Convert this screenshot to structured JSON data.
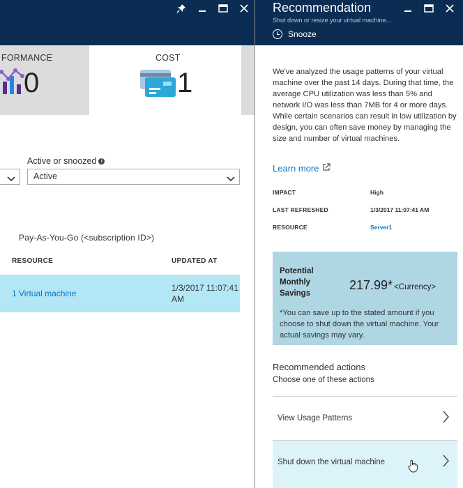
{
  "left_blade": {
    "tiles": {
      "performance": {
        "title": "FORMANCE",
        "count": "0",
        "icon": "performance-chart-icon"
      },
      "cost": {
        "title": "COST",
        "count": "1",
        "icon": "credit-card-icon"
      }
    },
    "filter": {
      "label": "Active or snoozed",
      "value": "Active",
      "info_icon": "info-icon"
    },
    "subscription": "Pay-As-You-Go (<subscription ID>)",
    "table": {
      "columns": [
        "RESOURCE",
        "UPDATED AT"
      ],
      "rows": [
        {
          "resource": "1 Virtual machine",
          "updated_at": "1/3/2017 11:07:41 AM"
        }
      ]
    }
  },
  "right_blade": {
    "title": "Recommendation",
    "subtitle": "Shut down or resize your virtual machine...",
    "snooze_label": "Snooze",
    "description": "We've analyzed the usage patterns of your virtual machine over the past 14 days. During that time, the average CPU utilization was less than 5% and network I/O was less than 7MB for 4 or more days. While certain scenarios can result in low utilization by design, you can often save money by managing the size and number of virtual machines.",
    "learn_more": "Learn more",
    "details": {
      "impact_label": "IMPACT",
      "impact_value": "High",
      "refreshed_label": "LAST REFRESHED",
      "refreshed_value": "1/3/2017 11:07:41 AM",
      "resource_label": "RESOURCE",
      "resource_value": "Server1"
    },
    "savings": {
      "label": "Potential Monthly Savings",
      "amount": "217.99*",
      "currency": "<Currency>",
      "note": "*You can save up to the stated amount if you choose to shut down the virtual machine. Your actual savings may vary."
    },
    "actions_title": "Recommended actions",
    "actions_subtitle": "Choose one of these actions",
    "actions": [
      {
        "label": "View Usage Patterns"
      },
      {
        "label": "Shut down the virtual machine"
      }
    ]
  },
  "colors": {
    "header_bg": "#0b2d53",
    "selected_row": "#b3e7f5",
    "savings_bg": "#afd6e3",
    "link": "#0b74c5"
  }
}
